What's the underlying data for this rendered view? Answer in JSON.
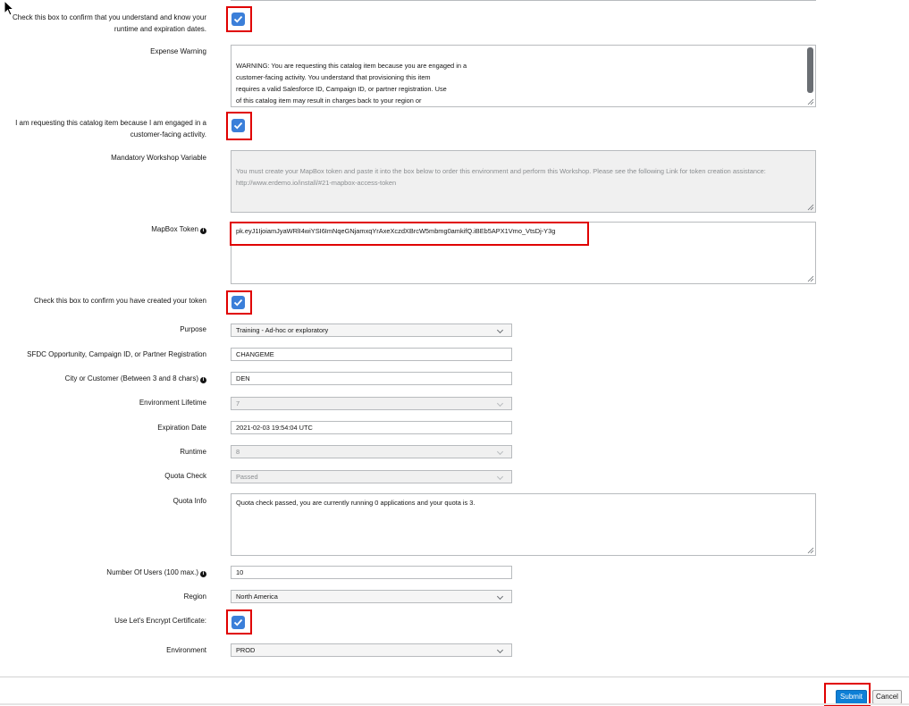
{
  "form": {
    "confirm_runtime_label": "Check this box to confirm that you understand and know your runtime and expiration dates.",
    "expense_warning_label": "Expense Warning",
    "expense_warning_text": "WARNING: You are requesting this catalog item because you are engaged in a\ncustomer-facing activity. You understand that provisioning this item\nrequires a valid Salesforce ID, Campaign ID, or partner registration. Use\nof this catalog item may result in charges back to your region or\norganization. Check the box below to accept these terms.",
    "customer_facing_label": "I am requesting this catalog item because I am engaged in a customer-facing activity.",
    "mandatory_workshop_label": "Mandatory Workshop Variable",
    "mandatory_workshop_text": "You must create your MapBox token and paste it into the box below to order this environment and perform this Workshop. Please see the following Link for token creation assistance:\nhttp://www.erdemo.io/install/#21-mapbox-access-token",
    "mapbox_token_label": "MapBox Token",
    "mapbox_token_value": "pk.eyJ1IjoiamJyaWRlI4wiYSI6ImNqeGNjamxqYrAxeXczdXBrcW5mbmg0amkifQ.iBEb5APX1Vmo_VtsDj-Y3g",
    "created_token_label": "Check this box to confirm you have created your token",
    "purpose_label": "Purpose",
    "purpose_value": "Training - Ad-hoc or exploratory",
    "sfdc_label": "SFDC Opportunity, Campaign ID, or Partner Registration",
    "sfdc_value": "CHANGEME",
    "city_label": "City or Customer (Between 3 and 8 chars)",
    "city_value": "DEN",
    "lifetime_label": "Environment Lifetime",
    "lifetime_value": "7",
    "expiration_label": "Expiration Date",
    "expiration_value": "2021-02-03 19:54:04 UTC",
    "runtime_label": "Runtime",
    "runtime_value": "8",
    "quota_check_label": "Quota Check",
    "quota_check_value": "Passed",
    "quota_info_label": "Quota Info",
    "quota_info_value": "Quota check passed, you are currently running 0 applications and your quota is 3.",
    "users_label": "Number Of Users (100 max.)",
    "users_value": "10",
    "region_label": "Region",
    "region_value": "North America",
    "letsencrypt_label": "Use Let's Encrypt Certificate:",
    "environment_label": "Environment",
    "environment_value": "PROD"
  },
  "info_glyph": "i",
  "buttons": {
    "submit": "Submit",
    "cancel": "Cancel"
  },
  "colors": {
    "accent": "#0d7fd6",
    "checkbox": "#3b7fd9",
    "highlight": "#e00000"
  }
}
